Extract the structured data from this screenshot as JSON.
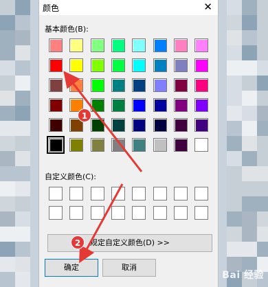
{
  "dialog": {
    "title": "颜色",
    "close_glyph": "✕",
    "basic_colors_label": "基本颜色(B):",
    "custom_colors_label": "自定义颜色(C):",
    "define_custom_button": "规定自定义颜色(D) >>",
    "ok_button": "确定",
    "cancel_button": "取消"
  },
  "basic_colors": [
    [
      "#ff8080",
      "#ffff80",
      "#80ff80",
      "#00ff80",
      "#80ffff",
      "#0080ff",
      "#ff80c0",
      "#ff80ff"
    ],
    [
      "#ff0000",
      "#ffff00",
      "#80ff00",
      "#00ff40",
      "#00ffff",
      "#0080c0",
      "#8080c0",
      "#ff00ff"
    ],
    [
      "#804040",
      "#ff8040",
      "#00ff00",
      "#008080",
      "#004080",
      "#8080ff",
      "#800040",
      "#ff0080"
    ],
    [
      "#800000",
      "#ff8000",
      "#008000",
      "#008040",
      "#0000ff",
      "#0000a0",
      "#800080",
      "#8000ff"
    ],
    [
      "#400000",
      "#804000",
      "#004000",
      "#004040",
      "#000080",
      "#000040",
      "#400040",
      "#400080"
    ],
    [
      "#000000",
      "#808000",
      "#808040",
      "#808080",
      "#408080",
      "#c0c0c0",
      "#400040",
      "#ffffff"
    ]
  ],
  "selected_color": {
    "row": 5,
    "col": 0
  },
  "custom_color_rows": 2,
  "custom_color_cols": 8,
  "annotations": {
    "badge1": "1",
    "badge2": "2"
  },
  "watermark": "Bai 经验"
}
